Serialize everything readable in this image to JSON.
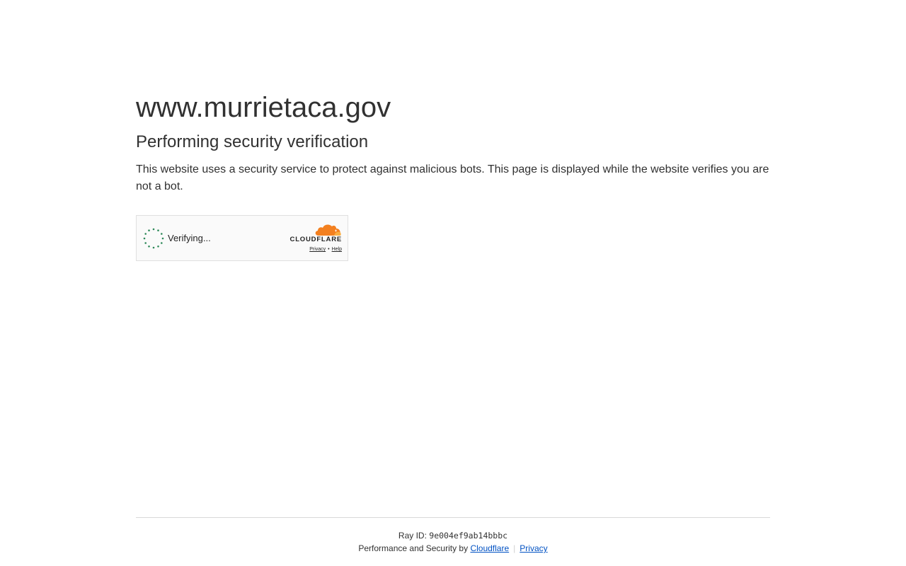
{
  "header": {
    "site_title": "www.murrietaca.gov",
    "subtitle": "Performing security verification",
    "description": "This website uses a security service to protect against malicious bots. This page is displayed while the website verifies you are not a bot."
  },
  "widget": {
    "status_text": "Verifying...",
    "brand_text": "CLOUDFLARE",
    "privacy_link": "Privacy",
    "link_separator": "•",
    "help_link": "Help",
    "icons": [
      "spinner-icon",
      "cloudflare-logo-icon"
    ],
    "colors": {
      "spinner": "#2f8a5a",
      "cloud_orange": "#f38020",
      "cloud_light": "#faae40"
    }
  },
  "footer": {
    "ray_label": "Ray ID:",
    "ray_id": "9e004ef9ab14bbbc",
    "perf_label": "Performance and Security by",
    "cloudflare_link": "Cloudflare",
    "separator": "|",
    "privacy_link": "Privacy",
    "link_color": "#0051c3"
  }
}
